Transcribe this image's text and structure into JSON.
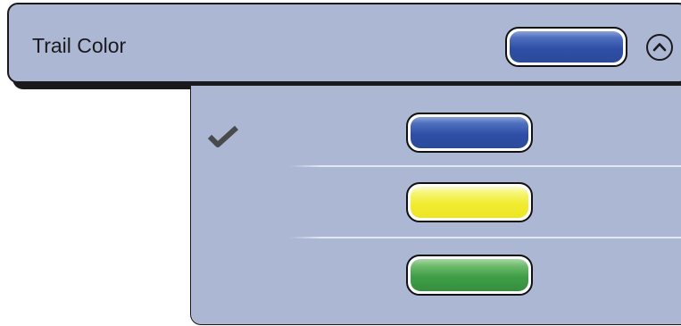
{
  "header": {
    "label": "Trail Color",
    "selected_color": "blue"
  },
  "options": [
    {
      "color": "blue",
      "selected": true
    },
    {
      "color": "yellow",
      "selected": false
    },
    {
      "color": "green",
      "selected": false
    }
  ],
  "colors": {
    "panel_background": "#acb7d4",
    "blue": "#2e4fa6",
    "yellow": "#f1ec2e",
    "green": "#3f9e47",
    "outline": "#1a1a1a"
  },
  "icons": {
    "selected_marker": "checkmark-icon",
    "collapse": "chevron-up-circle-icon"
  }
}
